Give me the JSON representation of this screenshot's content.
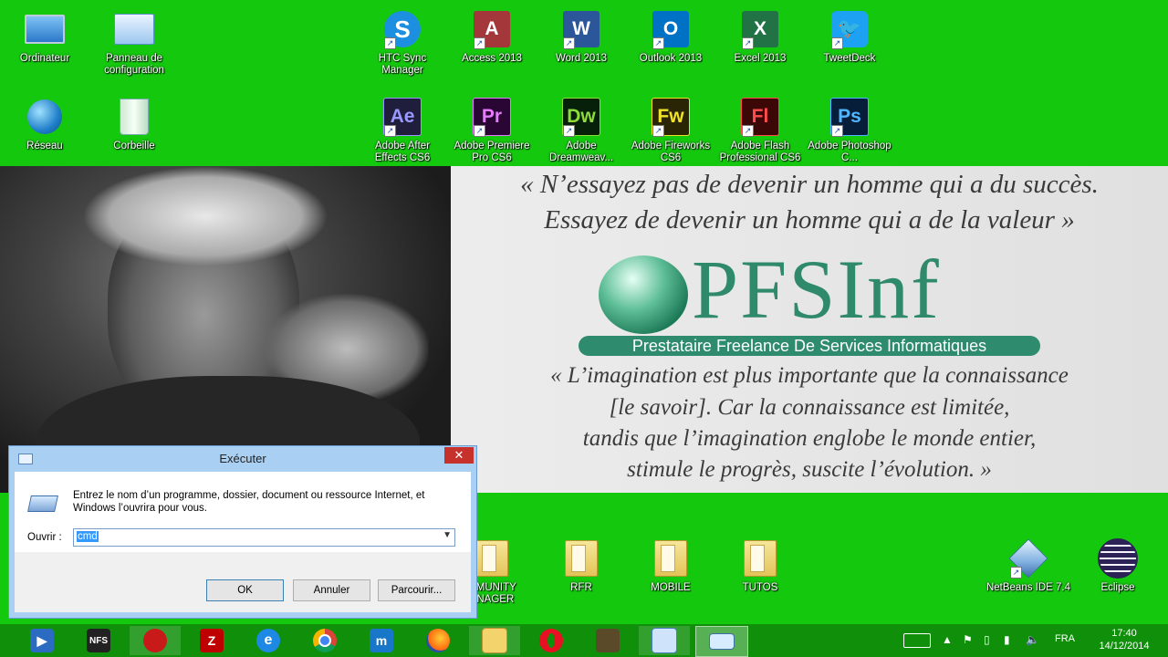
{
  "desktop_top": [
    {
      "label": "Ordinateur",
      "icon": "computer-icon"
    },
    {
      "label": "Panneau de configuration",
      "icon": "control-panel-icon"
    },
    {
      "label": "HTC Sync Manager",
      "icon": "htc-sync-icon"
    },
    {
      "label": "Access 2013",
      "icon": "access-icon",
      "abbr": "A"
    },
    {
      "label": "Word 2013",
      "icon": "word-icon",
      "abbr": "W"
    },
    {
      "label": "Outlook 2013",
      "icon": "outlook-icon",
      "abbr": "O"
    },
    {
      "label": "Excel 2013",
      "icon": "excel-icon",
      "abbr": "X"
    },
    {
      "label": "TweetDeck",
      "icon": "tweetdeck-icon"
    },
    {
      "label": "Réseau",
      "icon": "network-icon"
    },
    {
      "label": "Corbeille",
      "icon": "recycle-bin-icon"
    },
    {
      "label": "Adobe After Effects CS6",
      "icon": "after-effects-icon",
      "abbr": "Ae"
    },
    {
      "label": "Adobe Premiere Pro CS6",
      "icon": "premiere-icon",
      "abbr": "Pr"
    },
    {
      "label": "Adobe Dreamweav...",
      "icon": "dreamweaver-icon",
      "abbr": "Dw"
    },
    {
      "label": "Adobe Fireworks CS6",
      "icon": "fireworks-icon",
      "abbr": "Fw"
    },
    {
      "label": "Adobe Flash Professional CS6",
      "icon": "flash-icon",
      "abbr": "Fl"
    },
    {
      "label": "Adobe Photoshop C...",
      "icon": "photoshop-icon",
      "abbr": "Ps"
    }
  ],
  "desktop_bottom": [
    {
      "label": "MMUNITY ANAGER",
      "icon": "folder-icon"
    },
    {
      "label": "RFR",
      "icon": "folder-icon"
    },
    {
      "label": "MOBILE",
      "icon": "folder-icon"
    },
    {
      "label": "TUTOS",
      "icon": "folder-icon"
    },
    {
      "label": "NetBeans IDE 7.4",
      "icon": "netbeans-icon"
    },
    {
      "label": "Eclipse",
      "icon": "eclipse-icon"
    }
  ],
  "wallpaper": {
    "quote1_line1": "« N’essayez pas de devenir un homme qui a du succès.",
    "quote1_line2": "Essayez de devenir un homme qui a de la valeur »",
    "logo_text": "PFSInf",
    "logo_tagline": "Prestataire Freelance De Services Informatiques",
    "quote2_line1": "« L’imagination est plus importante que la connaissance",
    "quote2_line2": "[le savoir]. Car la connaissance est limitée,",
    "quote2_line3": "tandis que l’imagination englobe le monde entier,",
    "quote2_line4": "stimule le progrès, suscite l’évolution. »"
  },
  "run_dialog": {
    "title": "Exécuter",
    "description": "Entrez le nom d’un programme, dossier, document ou ressource Internet, et Windows l’ouvrira pour vous.",
    "open_label": "Ouvrir :",
    "input_value": "cmd",
    "ok": "OK",
    "cancel": "Annuler",
    "browse": "Parcourir..."
  },
  "taskbar": {
    "language": "FRA",
    "time": "17:40",
    "date": "14/12/2014"
  },
  "colors": {
    "desktop": "#14c80e",
    "taskbar": "#0f8f0a",
    "logo": "#2e8b6e"
  }
}
